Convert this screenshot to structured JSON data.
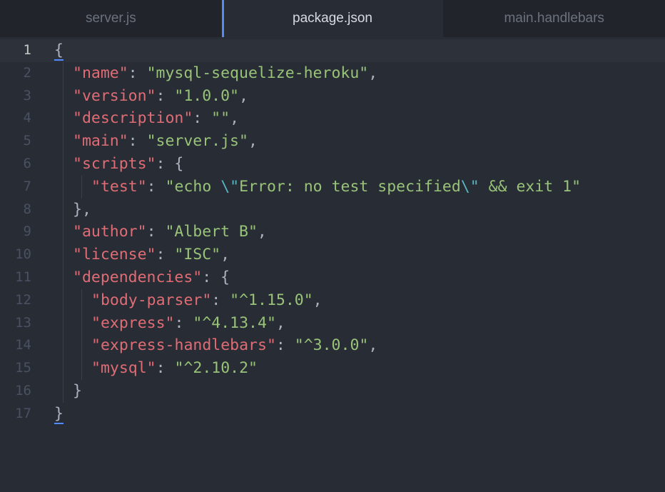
{
  "tabs": [
    {
      "label": "server.js",
      "active": false
    },
    {
      "label": "package.json",
      "active": true
    },
    {
      "label": "main.handlebars",
      "active": false
    }
  ],
  "code": {
    "lines": [
      {
        "num": "1",
        "indent": 0,
        "tokens": [
          {
            "t": "{",
            "c": "p"
          }
        ]
      },
      {
        "num": "2",
        "indent": 1,
        "tokens": [
          {
            "t": "\"name\"",
            "c": "k"
          },
          {
            "t": ": ",
            "c": "p"
          },
          {
            "t": "\"mysql-sequelize-heroku\"",
            "c": "s"
          },
          {
            "t": ",",
            "c": "p"
          }
        ]
      },
      {
        "num": "3",
        "indent": 1,
        "tokens": [
          {
            "t": "\"version\"",
            "c": "k"
          },
          {
            "t": ": ",
            "c": "p"
          },
          {
            "t": "\"1.0.0\"",
            "c": "s"
          },
          {
            "t": ",",
            "c": "p"
          }
        ]
      },
      {
        "num": "4",
        "indent": 1,
        "tokens": [
          {
            "t": "\"description\"",
            "c": "k"
          },
          {
            "t": ": ",
            "c": "p"
          },
          {
            "t": "\"\"",
            "c": "s"
          },
          {
            "t": ",",
            "c": "p"
          }
        ]
      },
      {
        "num": "5",
        "indent": 1,
        "tokens": [
          {
            "t": "\"main\"",
            "c": "k"
          },
          {
            "t": ": ",
            "c": "p"
          },
          {
            "t": "\"server.js\"",
            "c": "s"
          },
          {
            "t": ",",
            "c": "p"
          }
        ]
      },
      {
        "num": "6",
        "indent": 1,
        "tokens": [
          {
            "t": "\"scripts\"",
            "c": "k"
          },
          {
            "t": ": {",
            "c": "p"
          }
        ]
      },
      {
        "num": "7",
        "indent": 2,
        "tokens": [
          {
            "t": "\"test\"",
            "c": "k"
          },
          {
            "t": ": ",
            "c": "p"
          },
          {
            "t": "\"echo ",
            "c": "s"
          },
          {
            "t": "\\\"",
            "c": "e"
          },
          {
            "t": "Error: no test specified",
            "c": "s"
          },
          {
            "t": "\\\"",
            "c": "e"
          },
          {
            "t": " && exit 1\"",
            "c": "s"
          }
        ]
      },
      {
        "num": "8",
        "indent": 1,
        "tokens": [
          {
            "t": "},",
            "c": "p"
          }
        ]
      },
      {
        "num": "9",
        "indent": 1,
        "tokens": [
          {
            "t": "\"author\"",
            "c": "k"
          },
          {
            "t": ": ",
            "c": "p"
          },
          {
            "t": "\"Albert B\"",
            "c": "s"
          },
          {
            "t": ",",
            "c": "p"
          }
        ]
      },
      {
        "num": "10",
        "indent": 1,
        "tokens": [
          {
            "t": "\"license\"",
            "c": "k"
          },
          {
            "t": ": ",
            "c": "p"
          },
          {
            "t": "\"ISC\"",
            "c": "s"
          },
          {
            "t": ",",
            "c": "p"
          }
        ]
      },
      {
        "num": "11",
        "indent": 1,
        "tokens": [
          {
            "t": "\"dependencies\"",
            "c": "k"
          },
          {
            "t": ": {",
            "c": "p"
          }
        ]
      },
      {
        "num": "12",
        "indent": 2,
        "tokens": [
          {
            "t": "\"body-parser\"",
            "c": "k"
          },
          {
            "t": ": ",
            "c": "p"
          },
          {
            "t": "\"^1.15.0\"",
            "c": "s"
          },
          {
            "t": ",",
            "c": "p"
          }
        ]
      },
      {
        "num": "13",
        "indent": 2,
        "tokens": [
          {
            "t": "\"express\"",
            "c": "k"
          },
          {
            "t": ": ",
            "c": "p"
          },
          {
            "t": "\"^4.13.4\"",
            "c": "s"
          },
          {
            "t": ",",
            "c": "p"
          }
        ]
      },
      {
        "num": "14",
        "indent": 2,
        "tokens": [
          {
            "t": "\"express-handlebars\"",
            "c": "k"
          },
          {
            "t": ": ",
            "c": "p"
          },
          {
            "t": "\"^3.0.0\"",
            "c": "s"
          },
          {
            "t": ",",
            "c": "p"
          }
        ]
      },
      {
        "num": "15",
        "indent": 2,
        "tokens": [
          {
            "t": "\"mysql\"",
            "c": "k"
          },
          {
            "t": ": ",
            "c": "p"
          },
          {
            "t": "\"^2.10.2\"",
            "c": "s"
          }
        ]
      },
      {
        "num": "16",
        "indent": 1,
        "tokens": [
          {
            "t": "}",
            "c": "p"
          }
        ]
      },
      {
        "num": "17",
        "indent": 0,
        "tokens": [
          {
            "t": "}",
            "c": "p"
          }
        ]
      }
    ],
    "current_line": "1",
    "matched_brackets": [
      "1",
      "17"
    ]
  },
  "colors": {
    "background": "#282c34",
    "tab_bar": "#21252b",
    "active_tab_indicator": "#568af2",
    "key": "#e06c75",
    "string": "#98c379",
    "escape": "#56b6c2",
    "punctuation": "#abb2bf",
    "line_number": "#495162"
  }
}
